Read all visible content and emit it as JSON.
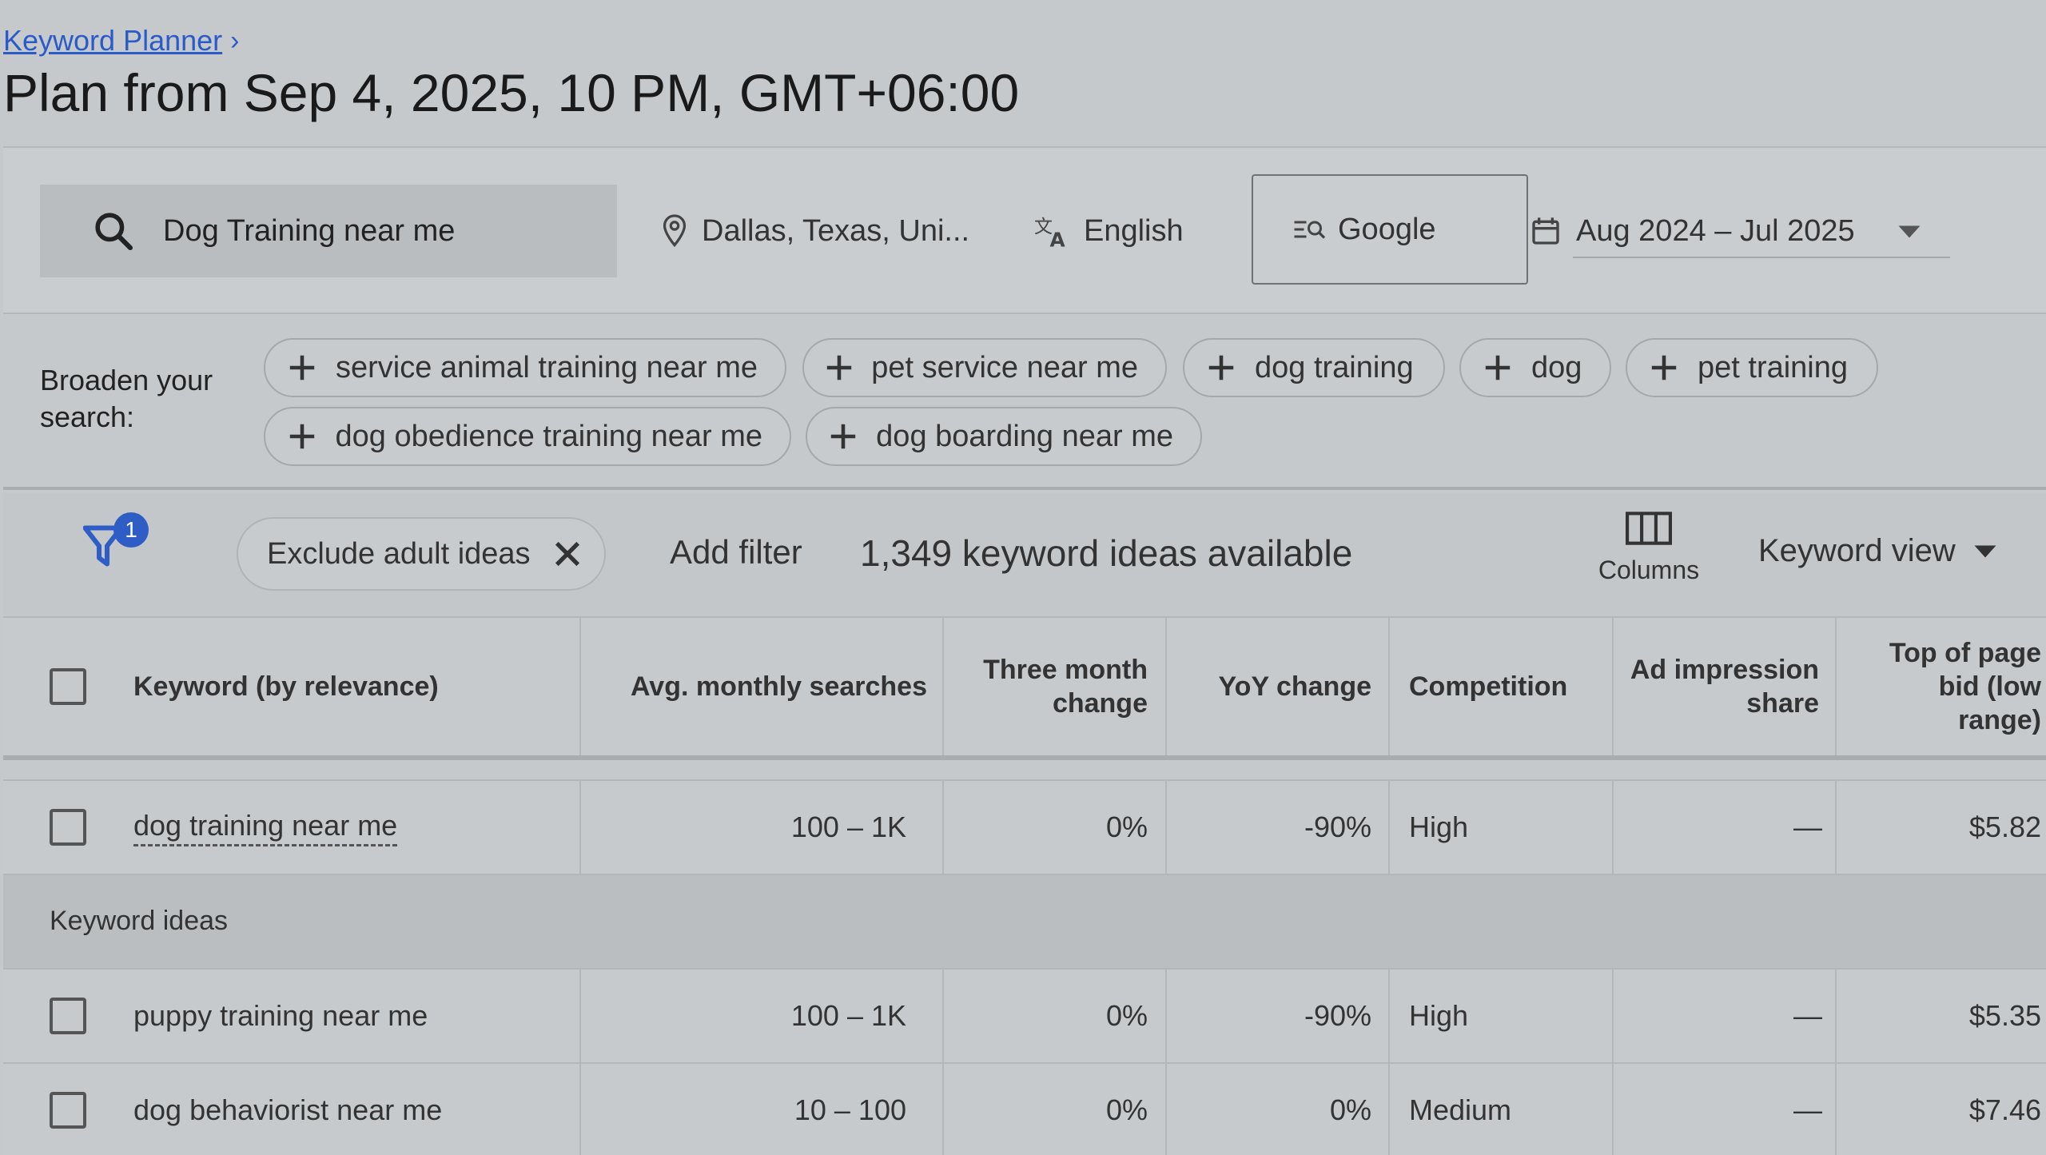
{
  "breadcrumb": {
    "label": "Keyword Planner",
    "chevron": "›"
  },
  "page": {
    "title": "Plan from Sep 4, 2025, 10 PM, GMT+06:00"
  },
  "toolbar": {
    "search_value": "Dog Training near me",
    "location": "Dallas, Texas, Uni...",
    "language": "English",
    "network": "Google",
    "date_range": "Aug 2024 – Jul 2025"
  },
  "broaden": {
    "label_line1": "Broaden your",
    "label_line2": "search:",
    "chips": [
      "service animal training near me",
      "pet service near me",
      "dog training",
      "dog",
      "pet training",
      "dog obedience training near me",
      "dog boarding near me"
    ]
  },
  "filters": {
    "badge_count": "1",
    "exclude_chip": "Exclude adult ideas",
    "add_filter": "Add filter",
    "ideas_available": "1,349 keyword ideas available",
    "columns_label": "Columns",
    "view_label": "Keyword view"
  },
  "table": {
    "headers": {
      "keyword": "Keyword (by relevance)",
      "avg_monthly": "Avg. monthly searches",
      "three_month_1": "Three month",
      "three_month_2": "change",
      "yoy": "YoY change",
      "competition": "Competition",
      "ad_impr_1": "Ad impression",
      "ad_impr_2": "share",
      "top_bid_1": "Top of page",
      "top_bid_2": "bid (low",
      "top_bid_3": "range)"
    },
    "main_row": {
      "keyword": "dog training near me",
      "avg": "100 – 1K",
      "three_month": "0%",
      "yoy": "-90%",
      "competition": "High",
      "ad_share": "—",
      "bid": "$5.82"
    },
    "section_label": "Keyword ideas",
    "rows": [
      {
        "keyword": "puppy training near me",
        "avg": "100 – 1K",
        "three_month": "0%",
        "yoy": "-90%",
        "competition": "High",
        "ad_share": "—",
        "bid": "$5.35"
      },
      {
        "keyword": "dog behaviorist near me",
        "avg": "10 – 100",
        "three_month": "0%",
        "yoy": "0%",
        "competition": "Medium",
        "ad_share": "—",
        "bid": "$7.46"
      }
    ]
  },
  "colors": {
    "link": "#2a5bc8",
    "badge": "#2f5dc6",
    "filter_icon": "#2f5dc6"
  }
}
